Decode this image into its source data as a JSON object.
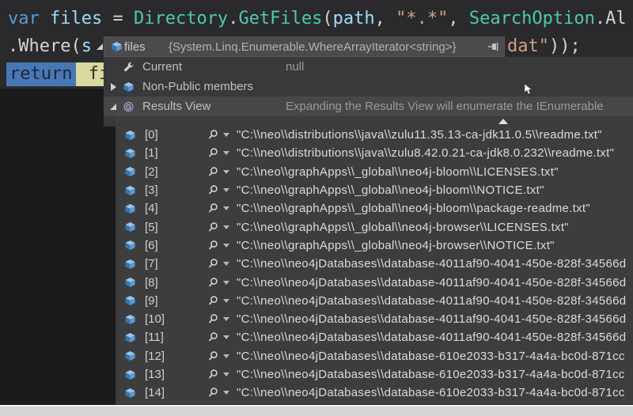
{
  "colors": {
    "editor_bg": "#2a2a2c",
    "editor_dark_bg": "#1b1b1d",
    "popup_bg": "#3d3d40",
    "popup_header_bg": "#4b4b4e",
    "hover_row_bg": "#47474a",
    "keyword": "#569cd6",
    "identifier": "#9cdcfe",
    "type": "#4ec9b0",
    "string": "#d69d85",
    "plain": "#d4d4d4",
    "selection_bg": "#4878b4",
    "highlight_bg": "#d9d9a0",
    "icon_blue": "#5b9bd5",
    "bottom_strip": "#d4d4d4"
  },
  "code": {
    "line1_tokens": [
      {
        "t": "var ",
        "c": "kw"
      },
      {
        "t": "files",
        "c": "id"
      },
      {
        "t": " = ",
        "c": "pl"
      },
      {
        "t": "Directory",
        "c": "ty"
      },
      {
        "t": ".",
        "c": "pl"
      },
      {
        "t": "GetFiles",
        "c": "ty"
      },
      {
        "t": "(",
        "c": "pl"
      },
      {
        "t": "path",
        "c": "id"
      },
      {
        "t": ", ",
        "c": "pl"
      },
      {
        "t": "\"*.*\"",
        "c": "str"
      },
      {
        "t": ", ",
        "c": "pl"
      },
      {
        "t": "SearchOption",
        "c": "ty"
      },
      {
        "t": ".Al",
        "c": "pl"
      }
    ],
    "line2_tokens": [
      {
        "t": ".Where(",
        "c": "pl"
      },
      {
        "t": "s",
        "c": "id"
      }
    ],
    "line2_right_tokens": [
      {
        "t": "dat\"",
        "c": "str"
      },
      {
        "t": "));",
        "c": "pl"
      }
    ],
    "line3_selected": "return",
    "line3_highlight": " fi"
  },
  "popup": {
    "header": {
      "name": "files",
      "value": "{System.Linq.Enumerable.WhereArrayIterator<string>}"
    },
    "members": [
      {
        "label": "Current",
        "value": "null"
      },
      {
        "label": "Non-Public members",
        "value": ""
      },
      {
        "label": "Results View",
        "value": "Expanding the Results View will enumerate the IEnumerable"
      }
    ],
    "results": {
      "rows": [
        {
          "index": "[0]",
          "value": "\"C:\\\\neo\\\\distributions\\\\java\\\\zulu11.35.13-ca-jdk11.0.5\\\\readme.txt\""
        },
        {
          "index": "[1]",
          "value": "\"C:\\\\neo\\\\distributions\\\\java\\\\zulu8.42.0.21-ca-jdk8.0.232\\\\readme.txt\""
        },
        {
          "index": "[2]",
          "value": "\"C:\\\\neo\\\\graphApps\\\\_global\\\\neo4j-bloom\\\\LICENSES.txt\""
        },
        {
          "index": "[3]",
          "value": "\"C:\\\\neo\\\\graphApps\\\\_global\\\\neo4j-bloom\\\\NOTICE.txt\""
        },
        {
          "index": "[4]",
          "value": "\"C:\\\\neo\\\\graphApps\\\\_global\\\\neo4j-bloom\\\\package-readme.txt\""
        },
        {
          "index": "[5]",
          "value": "\"C:\\\\neo\\\\graphApps\\\\_global\\\\neo4j-browser\\\\LICENSES.txt\""
        },
        {
          "index": "[6]",
          "value": "\"C:\\\\neo\\\\graphApps\\\\_global\\\\neo4j-browser\\\\NOTICE.txt\""
        },
        {
          "index": "[7]",
          "value": "\"C:\\\\neo\\\\neo4jDatabases\\\\database-4011af90-4041-450e-828f-34566d"
        },
        {
          "index": "[8]",
          "value": "\"C:\\\\neo\\\\neo4jDatabases\\\\database-4011af90-4041-450e-828f-34566d"
        },
        {
          "index": "[9]",
          "value": "\"C:\\\\neo\\\\neo4jDatabases\\\\database-4011af90-4041-450e-828f-34566d"
        },
        {
          "index": "[10]",
          "value": "\"C:\\\\neo\\\\neo4jDatabases\\\\database-4011af90-4041-450e-828f-34566d"
        },
        {
          "index": "[11]",
          "value": "\"C:\\\\neo\\\\neo4jDatabases\\\\database-4011af90-4041-450e-828f-34566d"
        },
        {
          "index": "[12]",
          "value": "\"C:\\\\neo\\\\neo4jDatabases\\\\database-610e2033-b317-4a4a-bc0d-871cc"
        },
        {
          "index": "[13]",
          "value": "\"C:\\\\neo\\\\neo4jDatabases\\\\database-610e2033-b317-4a4a-bc0d-871cc"
        },
        {
          "index": "[14]",
          "value": "\"C:\\\\neo\\\\neo4jDatabases\\\\database-610e2033-b317-4a4a-bc0d-871cc"
        }
      ]
    }
  }
}
